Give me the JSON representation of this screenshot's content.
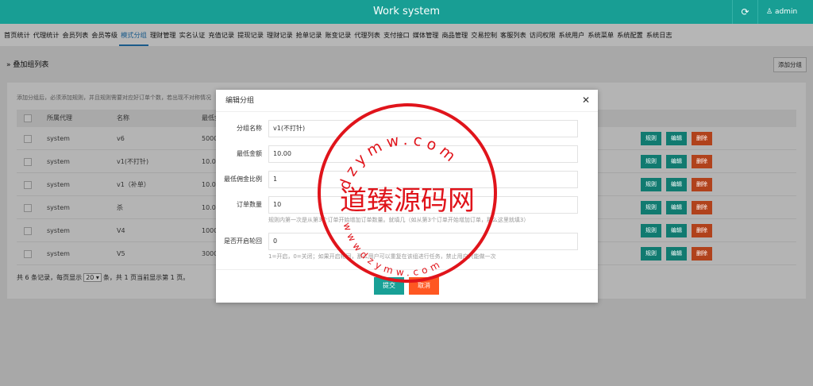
{
  "header": {
    "title": "Work system",
    "user": "admin"
  },
  "nav": [
    {
      "label": "首页统计"
    },
    {
      "label": "代理统计"
    },
    {
      "label": "会员列表"
    },
    {
      "label": "会员等级"
    },
    {
      "label": "模式分组",
      "active": true
    },
    {
      "label": "理财管理"
    },
    {
      "label": "实名认证"
    },
    {
      "label": "充值记录"
    },
    {
      "label": "提现记录"
    },
    {
      "label": "理财记录"
    },
    {
      "label": "抢单记录"
    },
    {
      "label": "账变记录"
    },
    {
      "label": "代理列表"
    },
    {
      "label": "支付接口"
    },
    {
      "label": "媒体管理"
    },
    {
      "label": "商品管理"
    },
    {
      "label": "交易控制"
    },
    {
      "label": "客服列表"
    },
    {
      "label": "访问权限"
    },
    {
      "label": "系统用户"
    },
    {
      "label": "系统菜单"
    },
    {
      "label": "系统配置"
    },
    {
      "label": "系统日志"
    }
  ],
  "breadcrumb": "» 叠加组列表",
  "add_button": "添加分组",
  "tip": "添加分组后，必须添加规则，并且规则需要对应好订单个数，若出现不对称情况",
  "table": {
    "columns": [
      "所属代理",
      "名称",
      "最低金"
    ],
    "rows": [
      {
        "agent": "system",
        "name": "v6",
        "min": "5000."
      },
      {
        "agent": "system",
        "name": "v1(不打针)",
        "min": "10.00"
      },
      {
        "agent": "system",
        "name": "v1（补单）",
        "min": "10.00"
      },
      {
        "agent": "system",
        "name": "杀",
        "min": "10.00"
      },
      {
        "agent": "system",
        "name": "V4",
        "min": "1000."
      },
      {
        "agent": "system",
        "name": "V5",
        "min": "3000."
      }
    ],
    "actions": [
      "规则",
      "编辑",
      "删除"
    ]
  },
  "pager": {
    "prefix": "共 6 条记录，每页显示",
    "page_size": "20",
    "suffix": "条，共 1 页当前显示第 1 页。"
  },
  "modal": {
    "title": "编辑分组",
    "fields": [
      {
        "label": "分组名称",
        "value": "v1(不打针)",
        "help": ""
      },
      {
        "label": "最低金额",
        "value": "10.00",
        "help": ""
      },
      {
        "label": "最低佣金比例",
        "value": "1",
        "help": ""
      },
      {
        "label": "订单数量",
        "value": "10",
        "help": "规则内第一次是从第3个订单开始增加订单数量。就填几（如从第3个订单开始增加订单，那么这里就填3）"
      },
      {
        "label": "是否开启轮回",
        "value": "0",
        "help": "1=开启，0=关闭；如果开启轮回，那么用户可以重复在该组进行任务，禁止用户只能做一次"
      }
    ],
    "submit": "提交",
    "cancel": "取消"
  },
  "watermark": {
    "center_text": "道臻源码网",
    "top_text": "dzymw.com",
    "bottom_text": "wwwdzymw.com",
    "color": "#e0141b"
  }
}
